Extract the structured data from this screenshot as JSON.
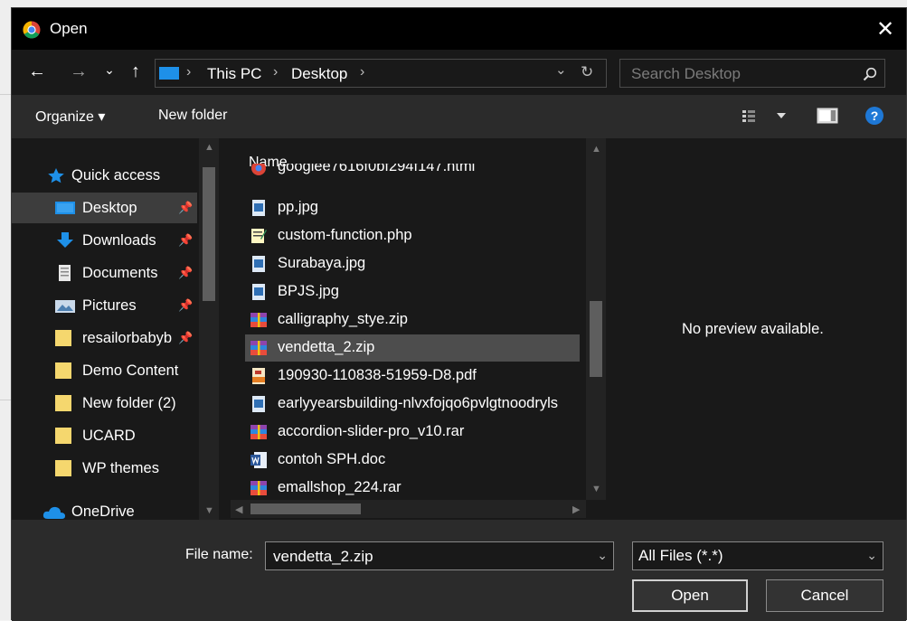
{
  "window": {
    "title": "Open",
    "close_glyph": "✕"
  },
  "nav": {
    "back": "←",
    "forward": "→",
    "recent": "⌄",
    "up": "↑",
    "breadcrumb": [
      "This PC",
      "Desktop"
    ],
    "dropdown_glyph": "⌄",
    "refresh_glyph": "↻",
    "sep": "›"
  },
  "search": {
    "placeholder": "Search Desktop"
  },
  "toolbar": {
    "organize": "Organize ▾",
    "new_folder": "New folder",
    "help": "?"
  },
  "sidebar": {
    "items": [
      {
        "label": "Quick access",
        "icon": "star-icon"
      },
      {
        "label": "Desktop",
        "icon": "desktop-icon",
        "pinned": true,
        "selected": true
      },
      {
        "label": "Downloads",
        "icon": "download-icon",
        "pinned": true
      },
      {
        "label": "Documents",
        "icon": "documents-icon",
        "pinned": true
      },
      {
        "label": "Pictures",
        "icon": "pictures-icon",
        "pinned": true
      },
      {
        "label": "resailorbabyb",
        "icon": "folder-icon",
        "pinned": true
      },
      {
        "label": "Demo Content",
        "icon": "folder-icon"
      },
      {
        "label": "New folder (2)",
        "icon": "folder-icon"
      },
      {
        "label": "UCARD",
        "icon": "folder-icon"
      },
      {
        "label": "WP themes",
        "icon": "folder-icon"
      },
      {
        "label": "OneDrive",
        "icon": "cloud-icon"
      }
    ],
    "pin_glyph": "📌"
  },
  "files": {
    "column_header": "Name",
    "partial_top": "googlee7616f0bf294f147.html",
    "items": [
      {
        "name": "pp.jpg",
        "icon": "image-file-icon"
      },
      {
        "name": "custom-function.php",
        "icon": "php-file-icon"
      },
      {
        "name": "Surabaya.jpg",
        "icon": "image-file-icon"
      },
      {
        "name": "BPJS.jpg",
        "icon": "image-file-icon"
      },
      {
        "name": "calligraphy_stye.zip",
        "icon": "archive-file-icon"
      },
      {
        "name": "vendetta_2.zip",
        "icon": "archive-file-icon",
        "selected": true
      },
      {
        "name": "190930-110838-51959-D8.pdf",
        "icon": "pdf-file-icon"
      },
      {
        "name": "earlyyearsbuilding-nlvxfojqo6pvlgtnoodryls",
        "icon": "image-file-icon"
      },
      {
        "name": "accordion-slider-pro_v10.rar",
        "icon": "archive-file-icon"
      },
      {
        "name": "contoh SPH.doc",
        "icon": "word-file-icon"
      },
      {
        "name": "emallshop_224.rar",
        "icon": "archive-file-icon"
      }
    ]
  },
  "preview": {
    "text": "No preview available."
  },
  "bottom": {
    "file_name_label": "File name:",
    "file_name_value": "vendetta_2.zip",
    "file_type": "All Files (*.*)",
    "open": "Open",
    "cancel": "Cancel"
  },
  "colors": {
    "accent": "#1e90e8",
    "selection": "#4d4d4d",
    "background": "#191919"
  }
}
